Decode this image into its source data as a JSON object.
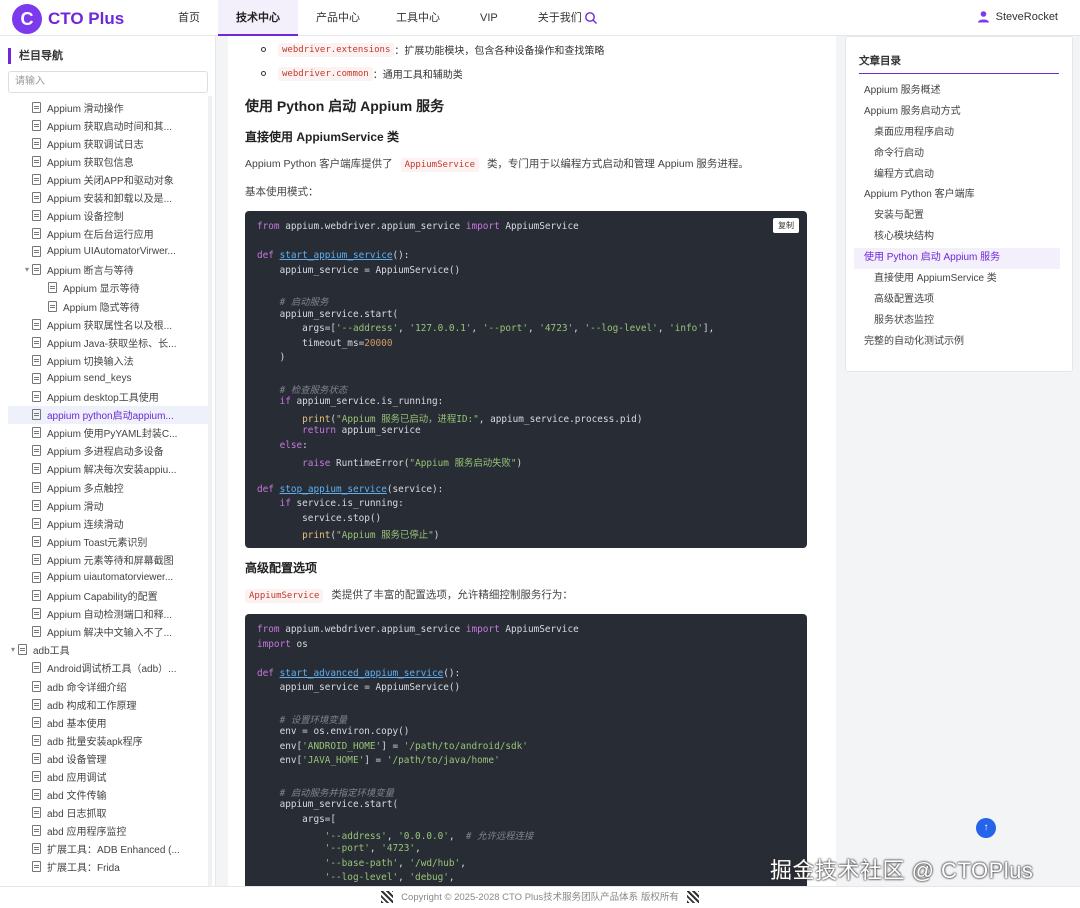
{
  "header": {
    "logo_letter": "C",
    "logo_text": "CTO Plus",
    "nav": [
      "首页",
      "技术中心",
      "产品中心",
      "工具中心",
      "VIP",
      "关于我们"
    ],
    "active_nav": "技术中心",
    "user": "SteveRocket"
  },
  "sidebar": {
    "title": "栏目导航",
    "search_placeholder": "请输入",
    "items": [
      {
        "label": "Appium 滑动操作",
        "level": 2
      },
      {
        "label": "Appium 获取启动时间和其...",
        "level": 2
      },
      {
        "label": "Appium 获取调试日志",
        "level": 2
      },
      {
        "label": "Appium 获取包信息",
        "level": 2
      },
      {
        "label": "Appium 关闭APP和驱动对象",
        "level": 2
      },
      {
        "label": "Appium 安装和卸载以及是...",
        "level": 2
      },
      {
        "label": "Appium 设备控制",
        "level": 2
      },
      {
        "label": "Appium 在后台运行应用",
        "level": 2
      },
      {
        "label": "Appium UIAutomatorVirwer...",
        "level": 2
      },
      {
        "label": "Appium 断言与等待",
        "level": 2,
        "expanded": true
      },
      {
        "label": "Appium 显示等待",
        "level": 3
      },
      {
        "label": "Appium 隐式等待",
        "level": 3
      },
      {
        "label": "Appium 获取属性名以及根...",
        "level": 2
      },
      {
        "label": "Appium Java-获取坐标、长...",
        "level": 2
      },
      {
        "label": "Appium 切换输入法",
        "level": 2
      },
      {
        "label": "Appium send_keys",
        "level": 2
      },
      {
        "label": "Appium desktop工具使用",
        "level": 2
      },
      {
        "label": "appium python启动appium...",
        "level": 2,
        "active": true
      },
      {
        "label": "Appium 使用PyYAML封装C...",
        "level": 2
      },
      {
        "label": "Appium 多进程启动多设备",
        "level": 2
      },
      {
        "label": "Appium 解决每次安装appiu...",
        "level": 2
      },
      {
        "label": "Appium 多点触控",
        "level": 2
      },
      {
        "label": "Appium 滑动",
        "level": 2
      },
      {
        "label": "Appium 连续滑动",
        "level": 2
      },
      {
        "label": "Appium Toast元素识别",
        "level": 2
      },
      {
        "label": "Appium 元素等待和屏幕截图",
        "level": 2
      },
      {
        "label": "Appium uiautomatorviewer...",
        "level": 2
      },
      {
        "label": "Appium Capability的配置",
        "level": 2
      },
      {
        "label": "Appium 自动检测端口和释...",
        "level": 2
      },
      {
        "label": "Appium 解决中文输入不了...",
        "level": 2
      },
      {
        "label": "adb工具",
        "level": 1,
        "expanded": true
      },
      {
        "label": "Android调试桥工具（adb）...",
        "level": 2
      },
      {
        "label": "adb 命令详细介绍",
        "level": 2
      },
      {
        "label": "adb 构成和工作原理",
        "level": 2
      },
      {
        "label": "abd 基本使用",
        "level": 2
      },
      {
        "label": "adb 批量安装apk程序",
        "level": 2
      },
      {
        "label": "abd 设备管理",
        "level": 2
      },
      {
        "label": "abd 应用调试",
        "level": 2
      },
      {
        "label": "abd 文件传输",
        "level": 2
      },
      {
        "label": "abd 日志抓取",
        "level": 2
      },
      {
        "label": "abd 应用程序监控",
        "level": 2
      },
      {
        "label": "扩展工具：ADB Enhanced (...",
        "level": 2
      },
      {
        "label": "扩展工具：Frida",
        "level": 2
      }
    ]
  },
  "article": {
    "bullet1_code": "webdriver.extensions",
    "bullet1_text": "：扩展功能模块，包含各种设备操作和查找策略",
    "bullet2_code": "webdriver.common",
    "bullet2_text": "：通用工具和辅助类",
    "h2": "使用 Python 启动 Appium 服务",
    "h3_1": "直接使用 AppiumService 类",
    "p1_before": "Appium Python 客户端库提供了",
    "p1_code": "AppiumService",
    "p1_after": "类，专门用于以编程方式启动和管理 Appium 服务进程。",
    "p2": "基本使用模式：",
    "copy_label": "复制",
    "h3_2": "高级配置选项",
    "p3_code": "AppiumService",
    "p3_after": "类提供了丰富的配置选项，允许精细控制服务行为："
  },
  "toc": {
    "title": "文章目录",
    "items": [
      {
        "label": "Appium 服务概述",
        "level": 1
      },
      {
        "label": "Appium 服务启动方式",
        "level": 1
      },
      {
        "label": "桌面应用程序启动",
        "level": 2
      },
      {
        "label": "命令行启动",
        "level": 2
      },
      {
        "label": "编程方式启动",
        "level": 2
      },
      {
        "label": "Appium Python 客户端库",
        "level": 1
      },
      {
        "label": "安装与配置",
        "level": 2
      },
      {
        "label": "核心模块结构",
        "level": 2
      },
      {
        "label": "使用 Python 启动 Appium 服务",
        "level": 1,
        "active": true
      },
      {
        "label": "直接使用 AppiumService 类",
        "level": 2
      },
      {
        "label": "高级配置选项",
        "level": 2
      },
      {
        "label": "服务状态监控",
        "level": 2
      },
      {
        "label": "完整的自动化测试示例",
        "level": 1
      }
    ]
  },
  "back_to_top": "↑",
  "watermark_text": "掘金技术社区 @ CTOPlus",
  "footer": {
    "before": "Copyright © 2025-2028 CTO Plus技术服务团队产品体系 版权所有"
  },
  "colors": {
    "accent": "#6d28d9",
    "code_bg": "#282c34",
    "link": "#2563eb"
  }
}
